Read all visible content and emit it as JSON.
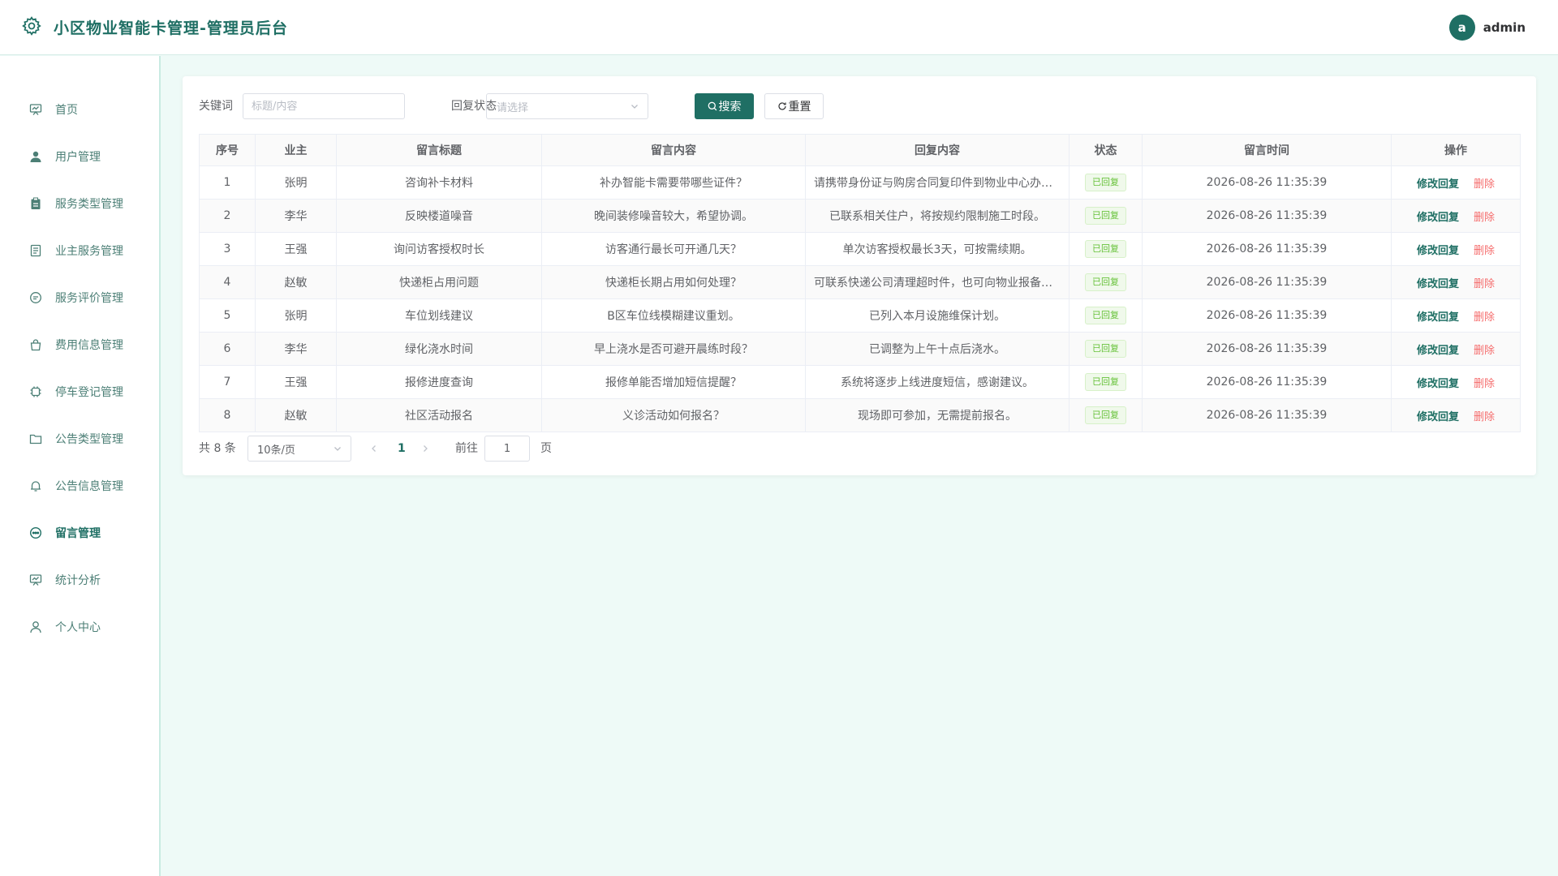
{
  "header": {
    "title": "小区物业智能卡管理-管理员后台",
    "user_initial": "a",
    "user_name": "admin"
  },
  "sidebar": {
    "items": [
      {
        "label": "首页",
        "icon": "dashboard-icon"
      },
      {
        "label": "用户管理",
        "icon": "user-icon"
      },
      {
        "label": "服务类型管理",
        "icon": "clipboard-icon"
      },
      {
        "label": "业主服务管理",
        "icon": "document-icon"
      },
      {
        "label": "服务评价管理",
        "icon": "comment-icon"
      },
      {
        "label": "费用信息管理",
        "icon": "bag-icon"
      },
      {
        "label": "停车登记管理",
        "icon": "cpu-icon"
      },
      {
        "label": "公告类型管理",
        "icon": "folder-icon"
      },
      {
        "label": "公告信息管理",
        "icon": "bell-icon"
      },
      {
        "label": "留言管理",
        "icon": "chat-icon",
        "active": true
      },
      {
        "label": "统计分析",
        "icon": "chart-icon"
      },
      {
        "label": "个人中心",
        "icon": "person-icon"
      }
    ]
  },
  "filters": {
    "keyword_label": "关键词",
    "keyword_placeholder": "标题/内容",
    "status_label": "回复状态",
    "status_placeholder": "请选择",
    "search_label": "搜索",
    "reset_label": "重置"
  },
  "table": {
    "columns": [
      "序号",
      "业主",
      "留言标题",
      "留言内容",
      "回复内容",
      "状态",
      "留言时间",
      "操作"
    ],
    "edit_label": "修改回复",
    "delete_label": "删除",
    "rows": [
      {
        "no": "1",
        "owner": "张明",
        "title": "咨询补卡材料",
        "content": "补办智能卡需要带哪些证件？",
        "reply": "请携带身份证与购房合同复印件到物业中心办理。",
        "status": "已回复",
        "time": "2026-08-26 11:35:39"
      },
      {
        "no": "2",
        "owner": "李华",
        "title": "反映楼道噪音",
        "content": "晚间装修噪音较大，希望协调。",
        "reply": "已联系相关住户，将按规约限制施工时段。",
        "status": "已回复",
        "time": "2026-08-26 11:35:39"
      },
      {
        "no": "3",
        "owner": "王强",
        "title": "询问访客授权时长",
        "content": "访客通行最长可开通几天？",
        "reply": "单次访客授权最长3天，可按需续期。",
        "status": "已回复",
        "time": "2026-08-26 11:35:39"
      },
      {
        "no": "4",
        "owner": "赵敏",
        "title": "快递柜占用问题",
        "content": "快递柜长期占用如何处理？",
        "reply": "可联系快递公司清理超时件，也可向物业报备处理。",
        "status": "已回复",
        "time": "2026-08-26 11:35:39"
      },
      {
        "no": "5",
        "owner": "张明",
        "title": "车位划线建议",
        "content": "B区车位线模糊建议重划。",
        "reply": "已列入本月设施维保计划。",
        "status": "已回复",
        "time": "2026-08-26 11:35:39"
      },
      {
        "no": "6",
        "owner": "李华",
        "title": "绿化浇水时间",
        "content": "早上浇水是否可避开晨练时段？",
        "reply": "已调整为上午十点后浇水。",
        "status": "已回复",
        "time": "2026-08-26 11:35:39"
      },
      {
        "no": "7",
        "owner": "王强",
        "title": "报修进度查询",
        "content": "报修单能否增加短信提醒？",
        "reply": "系统将逐步上线进度短信，感谢建议。",
        "status": "已回复",
        "time": "2026-08-26 11:35:39"
      },
      {
        "no": "8",
        "owner": "赵敏",
        "title": "社区活动报名",
        "content": "义诊活动如何报名？",
        "reply": "现场即可参加，无需提前报名。",
        "status": "已回复",
        "time": "2026-08-26 11:35:39"
      }
    ]
  },
  "pagination": {
    "total_text": "共 8 条",
    "page_size": "10条/页",
    "current_page": "1",
    "goto_label": "前往",
    "goto_value": "1",
    "page_suffix": "页"
  },
  "colors": {
    "brand": "#1f6f64",
    "danger": "#f56c6c",
    "success": "#67c23a",
    "page_bg": "#eefaf7"
  }
}
